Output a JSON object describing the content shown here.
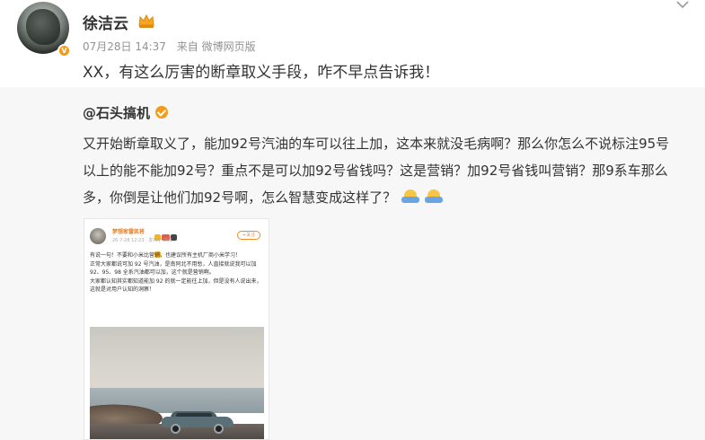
{
  "post": {
    "username": "徐洁云",
    "date": "07月28日 14:37",
    "source": "来自 微博网页版",
    "text": "XX，有这么厉害的断章取义手段，咋不早点告诉我！"
  },
  "repost": {
    "author": "@石头搞机",
    "text": "又开始断章取义了，能加92号汽油的车可以往上加，这本来就没毛病啊？那么你怎么不说标注95号以上的能不能加92号？重点不是可以加92号省钱吗？这是营销？加92号省钱叫营销？那9系车那么多，你倒是让他们加92号啊，怎么智慧变成这样了？",
    "embed": {
      "name": "梦想家雷凯将",
      "time": "26-7-28 12:23 · 发布于 浙江",
      "follow_label": "+关注",
      "lines": [
        "有说一句！不要和小米比营销，也建议所有主机厂商小米学习！",
        "正常大家都说可加 92 号汽油，是南阿北不用愁，人直接就说我可以加 92、95、98 全系汽油都可以加，这个就是营销啊。",
        "大家都认知其实都知道能加 92 的就一定能往上加，但是没有人说出来，这就是对用户认知的洞察！"
      ]
    }
  },
  "colors": {
    "accent": "#f29b1a",
    "repost_bg": "#f7f7f7",
    "meta_text": "#939393"
  },
  "icons": [
    "crown-icon",
    "chevron-down-icon",
    "verified-icon",
    "emoji-icon"
  ]
}
